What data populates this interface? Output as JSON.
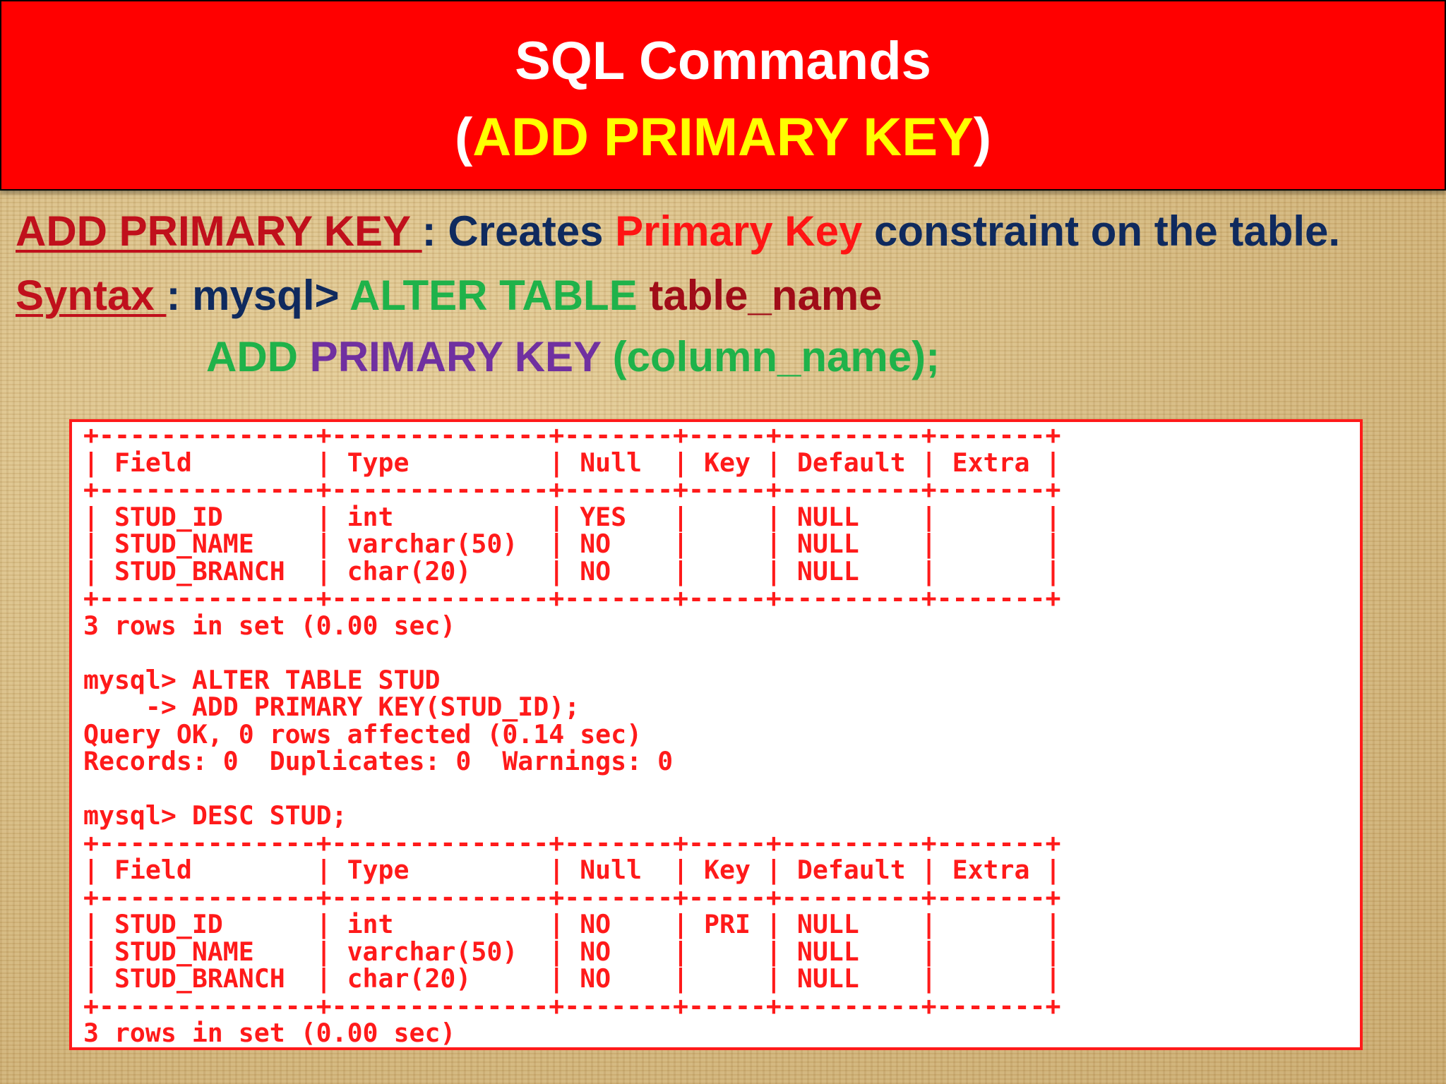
{
  "header": {
    "title": "SQL Commands",
    "subtitle_open": "(",
    "subtitle": "ADD PRIMARY KEY",
    "subtitle_close": ")"
  },
  "description": {
    "term": "ADD PRIMARY KEY ",
    "colon": " : ",
    "text_before": "Creates ",
    "highlight": "Primary Key",
    "text_after": " constraint on the table."
  },
  "syntax": {
    "label": "Syntax ",
    "colon": ": ",
    "prompt": "mysql> ",
    "keyword1": "ALTER TABLE ",
    "table_name": "table_name",
    "keyword2": "ADD ",
    "keyword3": "PRIMARY KEY ",
    "column_part": "(column_name);"
  },
  "terminal": {
    "lines": [
      "+--------------+--------------+-------+-----+---------+-------+",
      "| Field        | Type         | Null  | Key | Default | Extra |",
      "+--------------+--------------+-------+-----+---------+-------+",
      "| STUD_ID      | int          | YES   |     | NULL    |       |",
      "| STUD_NAME    | varchar(50)  | NO    |     | NULL    |       |",
      "| STUD_BRANCH  | char(20)     | NO    |     | NULL    |       |",
      "+--------------+--------------+-------+-----+---------+-------+",
      "3 rows in set (0.00 sec)",
      "",
      "mysql> ALTER TABLE STUD",
      "    -> ADD PRIMARY KEY(STUD_ID);",
      "Query OK, 0 rows affected (0.14 sec)",
      "Records: 0  Duplicates: 0  Warnings: 0",
      "",
      "mysql> DESC STUD;",
      "+--------------+--------------+-------+-----+---------+-------+",
      "| Field        | Type         | Null  | Key | Default | Extra |",
      "+--------------+--------------+-------+-----+---------+-------+",
      "| STUD_ID      | int          | NO    | PRI | NULL    |       |",
      "| STUD_NAME    | varchar(50)  | NO    |     | NULL    |       |",
      "| STUD_BRANCH  | char(20)     | NO    |     | NULL    |       |",
      "+--------------+--------------+-------+-----+---------+-------+",
      "3 rows in set (0.00 sec)"
    ]
  }
}
